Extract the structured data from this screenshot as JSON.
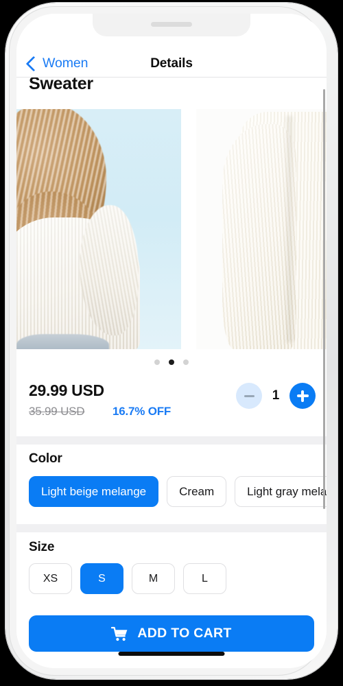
{
  "navbar": {
    "back_label": "Women",
    "back_icon": "chevron-left-icon",
    "title": "Details"
  },
  "product": {
    "title": "Sweater",
    "images": [
      {
        "alt": "model-back-view-cream-sweater"
      },
      {
        "alt": "cream-knit-sweater-flatlay"
      }
    ],
    "carousel": {
      "dots": 3,
      "active_index": 1
    },
    "price": {
      "current": "29.99 USD",
      "original": "35.99 USD",
      "discount": "16.7% OFF"
    },
    "quantity": {
      "value": "1",
      "minus_icon": "minus-icon",
      "plus_icon": "plus-icon",
      "minus_disabled": true
    },
    "color": {
      "label": "Color",
      "options": [
        {
          "label": "Light beige melange",
          "selected": true
        },
        {
          "label": "Cream",
          "selected": false
        },
        {
          "label": "Light gray melange",
          "selected": false
        }
      ]
    },
    "size": {
      "label": "Size",
      "options": [
        {
          "label": "XS",
          "selected": false
        },
        {
          "label": "S",
          "selected": true
        },
        {
          "label": "M",
          "selected": false
        },
        {
          "label": "L",
          "selected": false
        }
      ]
    }
  },
  "cta": {
    "label": "ADD TO CART",
    "icon": "shopping-cart-icon"
  },
  "colors": {
    "accent": "#0a7cf4",
    "link": "#1a7bf4",
    "text": "#111111",
    "muted": "#8c8c90",
    "divider": "#f0f0f2"
  }
}
